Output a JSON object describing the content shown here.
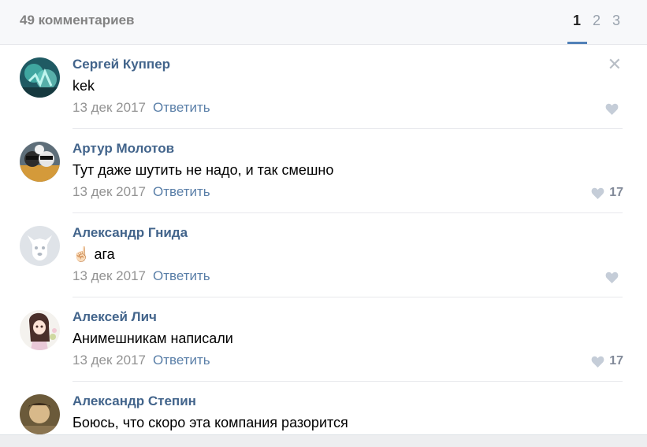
{
  "header": {
    "comments_count": "49 комментариев",
    "pages": [
      "1",
      "2",
      "3"
    ],
    "active_page": "1"
  },
  "comments": [
    {
      "author": "Сергей Куппер",
      "text": "kek",
      "date": "13 дек 2017",
      "reply": "Ответить",
      "likes": ""
    },
    {
      "author": "Артур Молотов",
      "text": "Тут даже шутить не надо, и так смешно",
      "date": "13 дек 2017",
      "reply": "Ответить",
      "likes": "17"
    },
    {
      "author": "Александр Гнида",
      "emoji": "☝🏻",
      "text": "ага",
      "date": "13 дек 2017",
      "reply": "Ответить",
      "likes": ""
    },
    {
      "author": "Алексей Лич",
      "text": "Анимешникам написали",
      "date": "13 дек 2017",
      "reply": "Ответить",
      "likes": "17"
    },
    {
      "author": "Александр Степин",
      "text": "Боюсь, что скоро эта компания разорится",
      "date": "",
      "reply": "",
      "likes": ""
    }
  ],
  "colors": {
    "link": "#42648b",
    "accent": "#5181b8",
    "muted": "#939393"
  },
  "icons": {
    "close": "close-icon",
    "like": "heart-icon"
  }
}
